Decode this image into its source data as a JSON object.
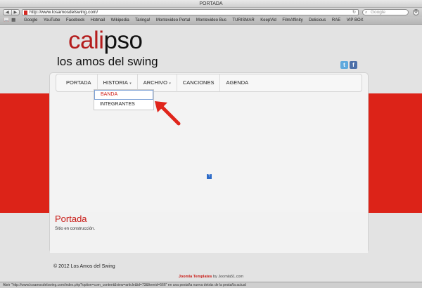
{
  "window": {
    "title": "PORTADA"
  },
  "toolbar": {
    "back_icon": "◀",
    "forward_icon": "▶",
    "url": "http://www.losamosdelswing.com/",
    "search_placeholder": "Google"
  },
  "bookmarks": [
    "Google",
    "YouTube",
    "Facebook",
    "Hotmail",
    "Wikipedia",
    "Taringa!",
    "Montevideo Portal",
    "Montevideo Bus",
    "TURISMAR",
    "KeepVid",
    "FilmAffinity",
    "Delicious",
    "RAE",
    "VIP BOX"
  ],
  "site": {
    "logo_part1": "cali",
    "logo_part2": "pso",
    "tagline": "los amos del swing",
    "accent_color": "#dc2318"
  },
  "menu": {
    "items": [
      "PORTADA",
      "HISTORIA",
      "ARCHIVO",
      "CANCIONES",
      "AGENDA"
    ],
    "dropdown": [
      "BANDA",
      "INTEGRANTES"
    ]
  },
  "article": {
    "title": "Portada",
    "body": "Sitio en construcción."
  },
  "footer": {
    "copyright": "© 2012 Los Amos del Swing",
    "credit_link": "Joomla Templates",
    "credit_rest": " by Joomla51.com"
  },
  "status": {
    "text": "Abrir \"http://www.losamosdelswing.com/index.php?option=com_content&view=article&id=73&Itemid=566\" en una pestaña nueva detrás de la pestaña actual"
  }
}
